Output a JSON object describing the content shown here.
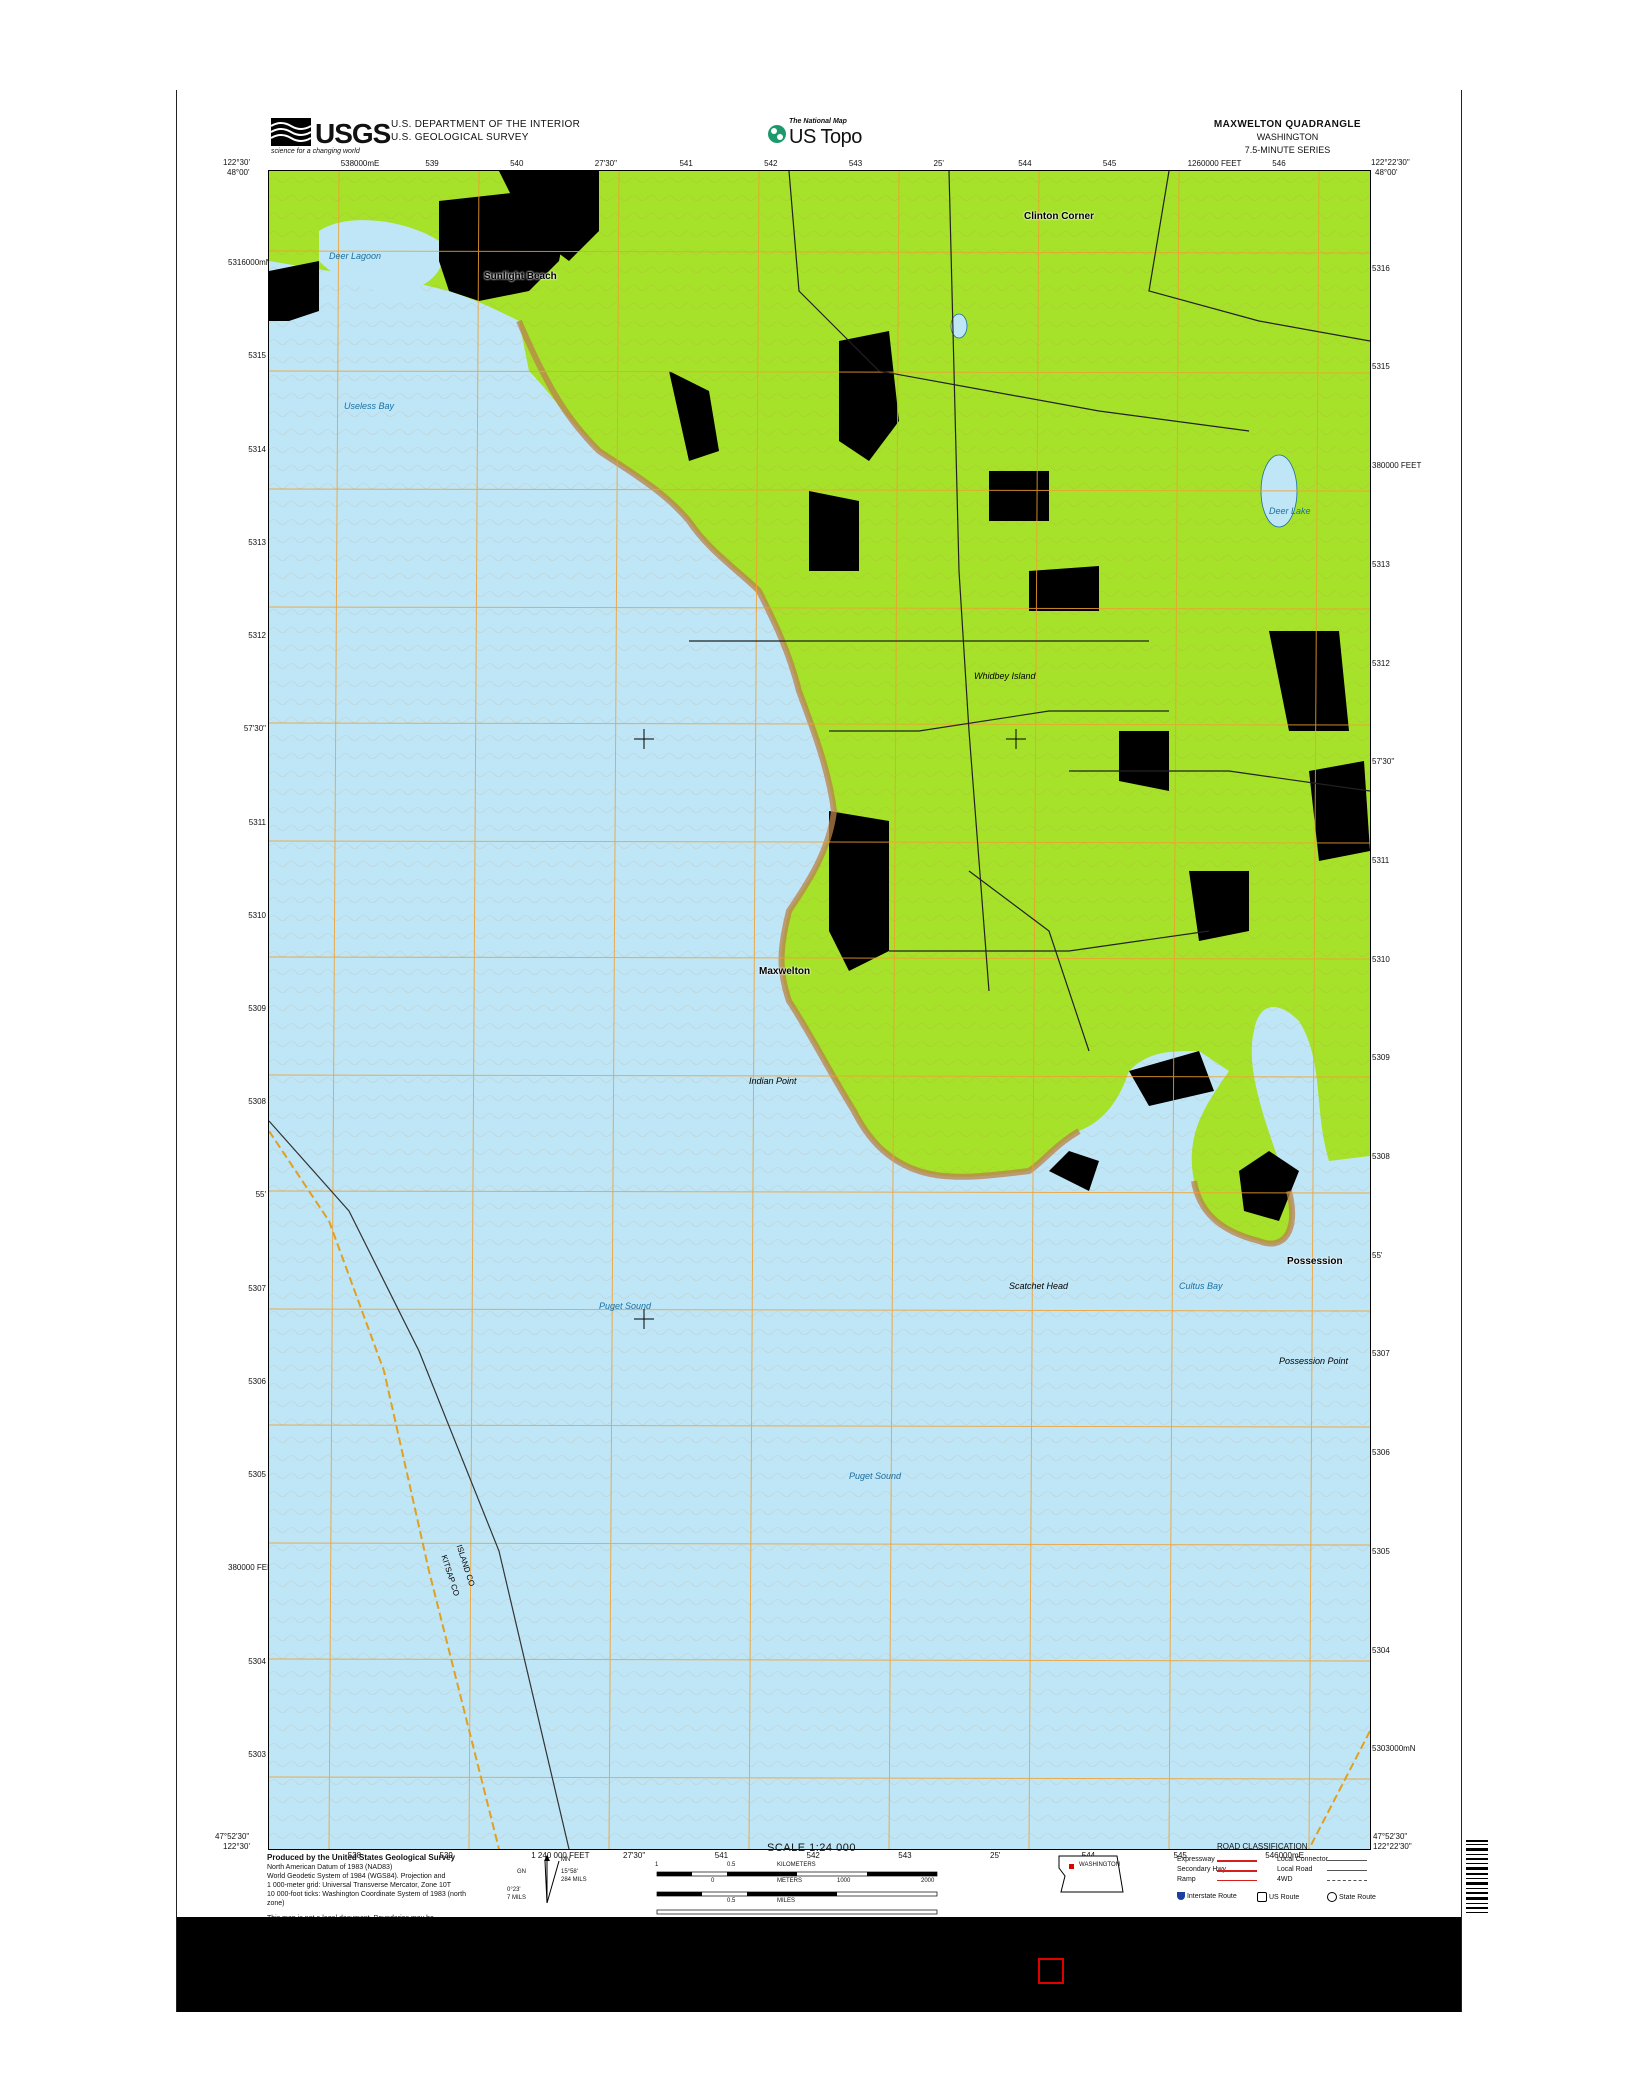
{
  "header": {
    "usgs_word": "USGS",
    "usgs_tagline": "science for a changing world",
    "department_line1": "U.S. DEPARTMENT OF THE INTERIOR",
    "department_line2": "U.S. GEOLOGICAL SURVEY",
    "national_map": "The National Map",
    "us_topo": "US Topo",
    "quad_name": "MAXWELTON QUADRANGLE",
    "state": "WASHINGTON",
    "series": "7.5-MINUTE SERIES"
  },
  "coords": {
    "top_left_lon": "122°30'",
    "top_left_lat": "48°00'",
    "top_right_lon": "122°22'30\"",
    "top_right_lat": "48°00'",
    "bottom_left_lon": "122°30'",
    "bottom_left_lat": "47°52'30\"",
    "bottom_right_lon": "122°22'30\"",
    "bottom_right_lat": "47°52'30\"",
    "top_ticks": [
      "538000mE",
      "539",
      "540",
      "27'30\"",
      "541",
      "542",
      "543",
      "25'",
      "544",
      "545",
      "1260000 FEET",
      "546"
    ],
    "bottom_ticks": [
      "538",
      "539",
      "1 240 000 FEET",
      "27'30\"",
      "541",
      "542",
      "543",
      "25'",
      "544",
      "545",
      "546000mE"
    ],
    "left_ticks": [
      "5316000mN",
      "5315",
      "5314",
      "5313",
      "5312",
      "57'30\"",
      "5311",
      "5310",
      "5309",
      "5308",
      "55'",
      "5307",
      "5306",
      "5305",
      "380000 FEET",
      "5304",
      "5303"
    ],
    "right_ticks": [
      "5316",
      "5315",
      "380000 FEET",
      "5313",
      "5312",
      "57'30\"",
      "5311",
      "5310",
      "5309",
      "5308",
      "55'",
      "5307",
      "5306",
      "5305",
      "5304",
      "5303000mN"
    ]
  },
  "map_labels": {
    "towns": [
      "Sunlight Beach",
      "Maxwelton",
      "Possession",
      "Clinton Corner"
    ],
    "water": [
      "Deer Lagoon",
      "Useless Bay",
      "Puget Sound",
      "Puget Sound",
      "Deer Lake",
      "Cultus Bay"
    ],
    "land": [
      "Whidbey Island",
      "Indian Point",
      "Scatchet Head",
      "Possession Point"
    ],
    "county_line_1": "ISLAND CO",
    "county_line_2": "KITSAP CO"
  },
  "footer": {
    "produced_by": "Produced by the United States Geological Survey",
    "datum_lines": [
      "North American Datum of 1983 (NAD83)",
      "World Geodetic System of 1984 (WGS84). Projection and",
      "1 000-meter grid: Universal Transverse Mercator, Zone 10T",
      "10 000-foot ticks: Washington Coordinate System of 1983 (north",
      "zone)"
    ],
    "legal_note": "This map is not a legal document. Boundaries may be",
    "declination_mn": "MN",
    "declination_gn": "GN",
    "declination_values": [
      "15°58'",
      "284 MILS",
      "0°23'",
      "7 MILS"
    ],
    "scale_title": "SCALE 1:24 000",
    "scale_units": [
      "KILOMETERS",
      "METERS",
      "MILES",
      "FEET"
    ],
    "km_ticks": [
      "1",
      "0.5",
      "0",
      "1"
    ],
    "m_ticks": [
      "1000",
      "500",
      "0",
      "1000",
      "2000"
    ],
    "mi_ticks": [
      "1",
      "0.5",
      "0",
      "1"
    ],
    "locator_state": "WASHINGTON",
    "road_classification_title": "ROAD CLASSIFICATION",
    "road_classes": [
      "Expressway",
      "Secondary Hwy",
      "Ramp",
      "Local Connector",
      "Local Road",
      "4WD"
    ],
    "route_types": [
      "Interstate Route",
      "US Route",
      "State Route"
    ]
  },
  "colors": {
    "water": "#bfe6f7",
    "vegetation": "#a6e22a",
    "urban": "#000000",
    "contour": "#b8824a",
    "grid": "#f0a030",
    "band": "#000000",
    "highlight_box": "#e00000"
  }
}
